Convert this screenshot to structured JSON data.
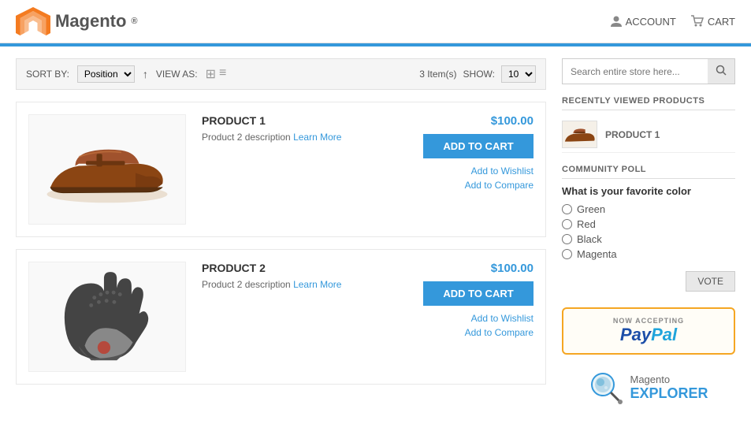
{
  "header": {
    "logo_text": "Magento",
    "logo_reg": "®",
    "account_label": "ACCOUNT",
    "cart_label": "CART",
    "search_placeholder": "Search entire store here...",
    "accent_color": "#3498db"
  },
  "toolbar": {
    "sort_by_label": "SORT BY:",
    "sort_option": "Position",
    "view_as_label": "VIEW AS:",
    "item_count": "3 Item(s)",
    "show_label": "SHOW:",
    "show_value": "10"
  },
  "products": [
    {
      "id": "product-1",
      "name": "PRODUCT 1",
      "description": "Product 2 description",
      "learn_more": "Learn More",
      "price": "$100.00",
      "add_to_cart": "ADD TO CART",
      "wishlist": "Add to Wishlist",
      "compare": "Add to Compare",
      "image_type": "shoe"
    },
    {
      "id": "product-2",
      "name": "PRODUCT 2",
      "description": "Product 2 description",
      "learn_more": "Learn More",
      "price": "$100.00",
      "add_to_cart": "ADD TO CART",
      "wishlist": "Add to Wishlist",
      "compare": "Add to Compare",
      "image_type": "glove"
    }
  ],
  "sidebar": {
    "recently_viewed_title": "RECENTLY VIEWED PRODUCTS",
    "recently_viewed_item": "PRODUCT 1",
    "community_poll_title": "COMMUNITY POLL",
    "poll_question": "What is your favorite color",
    "poll_options": [
      "Green",
      "Red",
      "Black",
      "Magenta"
    ],
    "vote_label": "VOTE",
    "paypal_now": "NOW ACCEPTING",
    "paypal_text": "PayPal",
    "magento_label": "Magento",
    "explorer_label": "EXPLORER"
  }
}
